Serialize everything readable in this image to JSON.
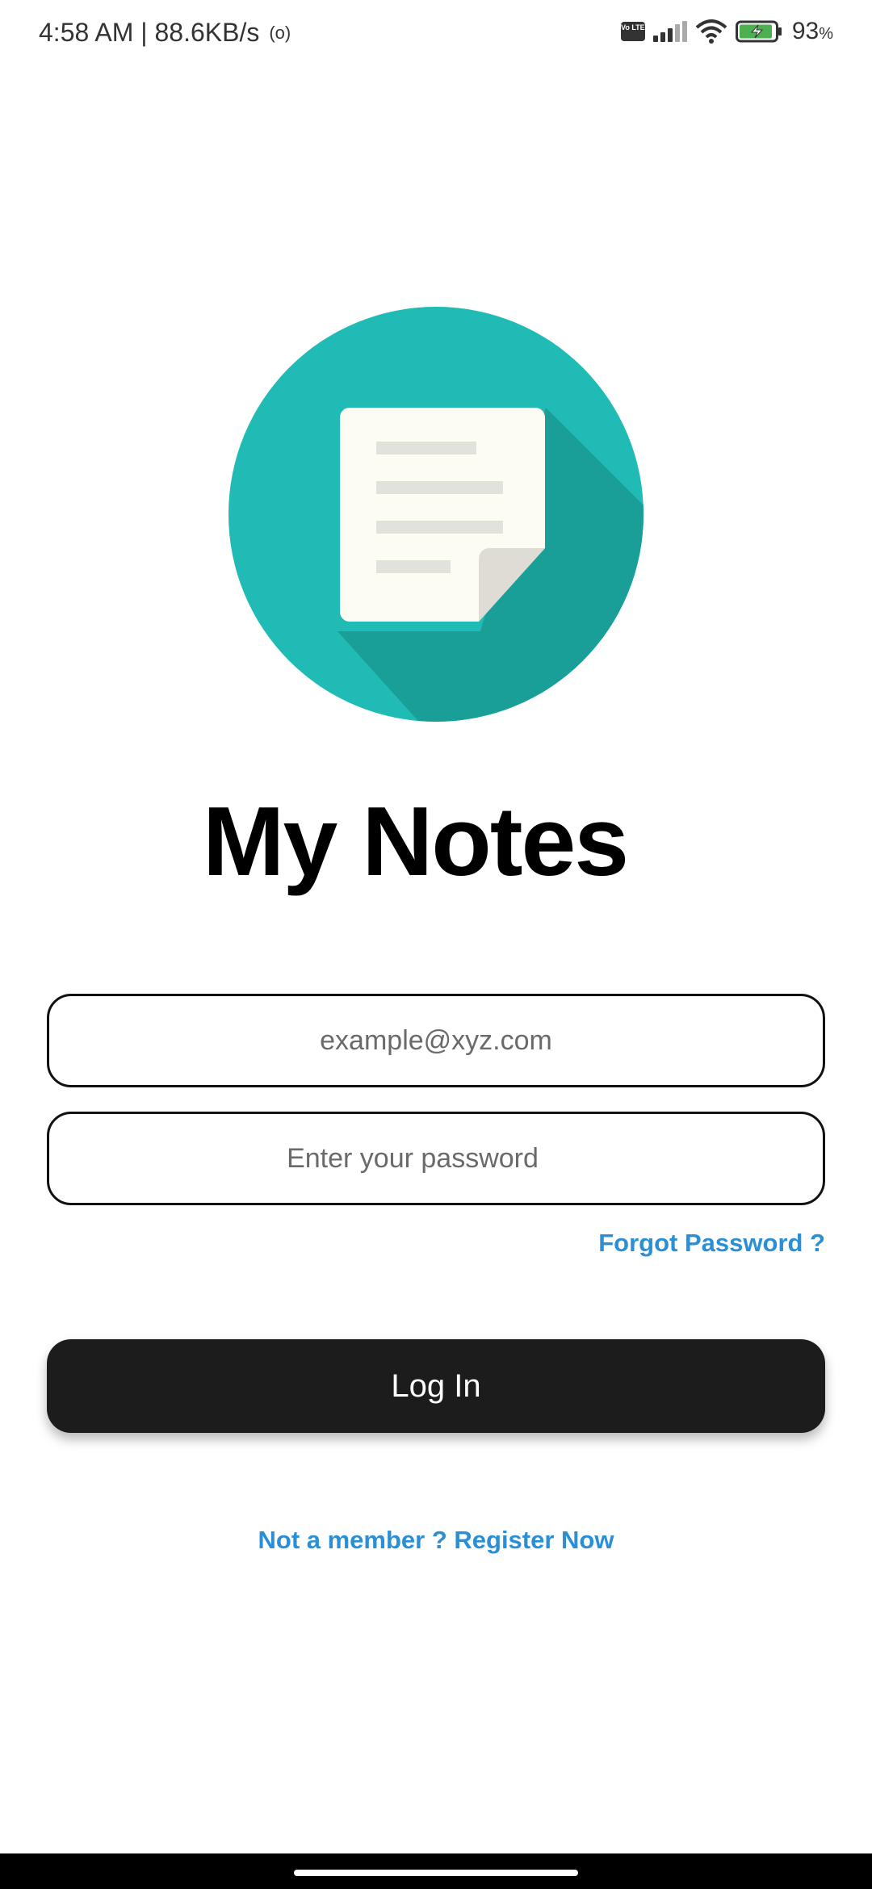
{
  "status_bar": {
    "time_speed": "4:58 AM | 88.6KB/s",
    "hotspot_glyph": "(o)",
    "volte_label": "Vo LTE",
    "battery_percent": "93",
    "battery_unit": "%",
    "battery_level": 0.93,
    "battery_color": "#4caf50"
  },
  "logo": {
    "circle_color": "#1fbbb4",
    "shadow_color": "#1a9e98",
    "note_color": "#fdfcf2",
    "line_color": "#e2e2dc",
    "icon": "notes-icon"
  },
  "app": {
    "title": "My Notes"
  },
  "login": {
    "email_placeholder": "example@xyz.com",
    "password_placeholder": "Enter your password",
    "forgot_password": "Forgot Password ?",
    "login_button": "Log In",
    "register_link": "Not a member ? Register Now",
    "link_color": "#2b8fd6",
    "button_color": "#1c1c1c"
  }
}
